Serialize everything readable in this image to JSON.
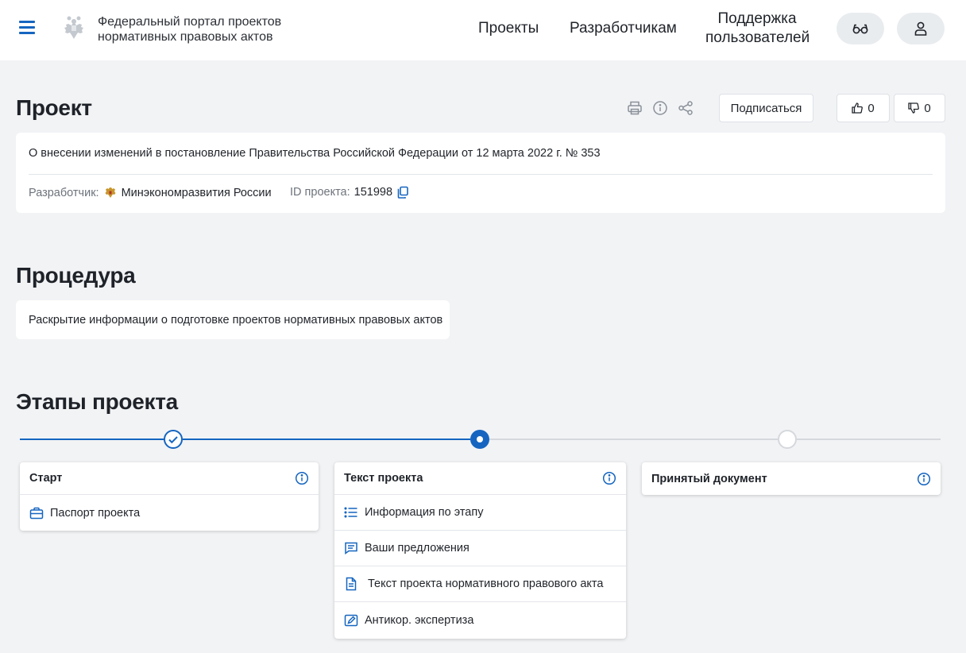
{
  "header": {
    "portal_title_line1": "Федеральный портал проектов",
    "portal_title_line2": "нормативных правовых актов",
    "nav": {
      "projects": "Проекты",
      "developers": "Разработчикам",
      "support_line1": "Поддержка",
      "support_line2": "пользователей"
    },
    "icons": [
      "menu-icon",
      "emblem-icon",
      "glasses-icon",
      "user-icon"
    ]
  },
  "project": {
    "heading": "Проект",
    "subscribe_label": "Подписаться",
    "likes": "0",
    "dislikes": "0",
    "name": "О внесении изменений в постановление Правительства Российской Федерации от 12 марта 2022 г. № 353",
    "developer_label": "Разработчик:",
    "developer_value": "Минэкономразвития России",
    "id_label": "ID проекта:",
    "id_value": "151998"
  },
  "procedure": {
    "heading": "Процедура",
    "text": "Раскрытие информации о подготовке проектов нормативных правовых актов"
  },
  "stages": {
    "heading": "Этапы проекта",
    "items": [
      {
        "title": "Старт",
        "status": "done",
        "links": [
          {
            "label": "Паспорт проекта",
            "icon": "briefcase-icon"
          }
        ]
      },
      {
        "title": "Текст проекта",
        "status": "current",
        "links": [
          {
            "label": "Информация по этапу",
            "icon": "list-icon"
          },
          {
            "label": "Ваши предложения",
            "icon": "comment-icon"
          },
          {
            "label": "Текст проекта нормативного правового акта",
            "icon": "document-icon"
          },
          {
            "label": "Антикор. экспертиза",
            "icon": "edit-icon"
          }
        ]
      },
      {
        "title": "Принятый документ",
        "status": "future",
        "links": []
      }
    ]
  },
  "colors": {
    "accent": "#1565c0",
    "background": "#f2f3f5",
    "inactive": "#d5d8dc"
  }
}
